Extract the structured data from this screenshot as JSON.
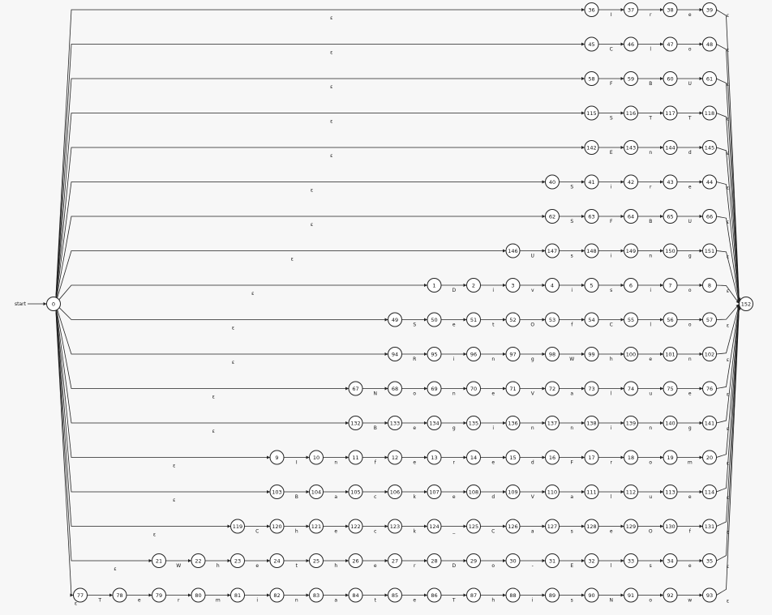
{
  "start_label": "start",
  "start_state": "0",
  "final_state": "152",
  "epsilon_label": "ε",
  "branches": [
    {
      "states": [
        "36",
        "37",
        "38",
        "39"
      ],
      "labels": [
        "I",
        "r",
        "e"
      ]
    },
    {
      "states": [
        "45",
        "46",
        "47",
        "48"
      ],
      "labels": [
        "C",
        "l",
        "o"
      ]
    },
    {
      "states": [
        "58",
        "59",
        "60",
        "61"
      ],
      "labels": [
        "F",
        "B",
        "U"
      ]
    },
    {
      "states": [
        "115",
        "116",
        "117",
        "118"
      ],
      "labels": [
        "S",
        "T",
        "T"
      ]
    },
    {
      "states": [
        "142",
        "143",
        "144",
        "145"
      ],
      "labels": [
        "E",
        "n",
        "d"
      ]
    },
    {
      "states": [
        "40",
        "41",
        "42",
        "43",
        "44"
      ],
      "labels": [
        "S",
        "i",
        "r",
        "e"
      ]
    },
    {
      "states": [
        "62",
        "63",
        "64",
        "65",
        "66"
      ],
      "labels": [
        "S",
        "F",
        "B",
        "U"
      ]
    },
    {
      "states": [
        "146",
        "147",
        "148",
        "149",
        "150",
        "151"
      ],
      "labels": [
        "U",
        "s",
        "i",
        "n",
        "g"
      ]
    },
    {
      "states": [
        "1",
        "2",
        "3",
        "4",
        "5",
        "6",
        "7",
        "8"
      ],
      "labels": [
        "D",
        "i",
        "v",
        "i",
        "s",
        "i",
        "o"
      ]
    },
    {
      "states": [
        "49",
        "50",
        "51",
        "52",
        "53",
        "54",
        "55",
        "56",
        "57"
      ],
      "labels": [
        "S",
        "e",
        "t",
        "O",
        "f",
        "C",
        "l",
        "o"
      ]
    },
    {
      "states": [
        "94",
        "95",
        "96",
        "97",
        "98",
        "99",
        "100",
        "101",
        "102"
      ],
      "labels": [
        "R",
        "i",
        "n",
        "g",
        "W",
        "h",
        "e",
        "n"
      ]
    },
    {
      "states": [
        "67",
        "68",
        "69",
        "70",
        "71",
        "72",
        "73",
        "74",
        "75",
        "76"
      ],
      "labels": [
        "N",
        "o",
        "n",
        "e",
        "V",
        "a",
        "l",
        "u",
        "e"
      ]
    },
    {
      "states": [
        "132",
        "133",
        "134",
        "135",
        "136",
        "137",
        "138",
        "139",
        "140",
        "141"
      ],
      "labels": [
        "B",
        "e",
        "g",
        "i",
        "n",
        "n",
        "i",
        "n",
        "g"
      ]
    },
    {
      "states": [
        "9",
        "10",
        "11",
        "12",
        "13",
        "14",
        "15",
        "16",
        "17",
        "18",
        "19",
        "20"
      ],
      "labels": [
        "I",
        "n",
        "f",
        "e",
        "r",
        "e",
        "d",
        "F",
        "r",
        "o",
        "m"
      ]
    },
    {
      "states": [
        "103",
        "104",
        "105",
        "106",
        "107",
        "108",
        "109",
        "110",
        "111",
        "112",
        "113",
        "114"
      ],
      "labels": [
        "B",
        "a",
        "c",
        "k",
        "e",
        "d",
        "V",
        "a",
        "l",
        "u",
        "e"
      ]
    },
    {
      "states": [
        "119",
        "120",
        "121",
        "122",
        "123",
        "124",
        "125",
        "126",
        "127",
        "128",
        "129",
        "130",
        "131"
      ],
      "labels": [
        "C",
        "h",
        "e",
        "c",
        "k",
        "_",
        "C",
        "a",
        "s",
        "e",
        "O",
        "f"
      ]
    },
    {
      "states": [
        "21",
        "22",
        "23",
        "24",
        "25",
        "26",
        "27",
        "28",
        "29",
        "30",
        "31",
        "32",
        "33",
        "34",
        "35"
      ],
      "labels": [
        "W",
        "h",
        "e",
        "t",
        "h",
        "e",
        "r",
        "D",
        "o",
        "-",
        "E",
        "l",
        "s",
        "e"
      ]
    },
    {
      "states": [
        "77",
        "78",
        "79",
        "80",
        "81",
        "82",
        "83",
        "84",
        "85",
        "86",
        "87",
        "88",
        "89",
        "90",
        "91",
        "92",
        "93"
      ],
      "labels": [
        "T",
        "e",
        "r",
        "m",
        "i",
        "n",
        "a",
        "t",
        "e",
        "T",
        "h",
        "i",
        "s",
        "N",
        "o",
        "w"
      ]
    }
  ]
}
